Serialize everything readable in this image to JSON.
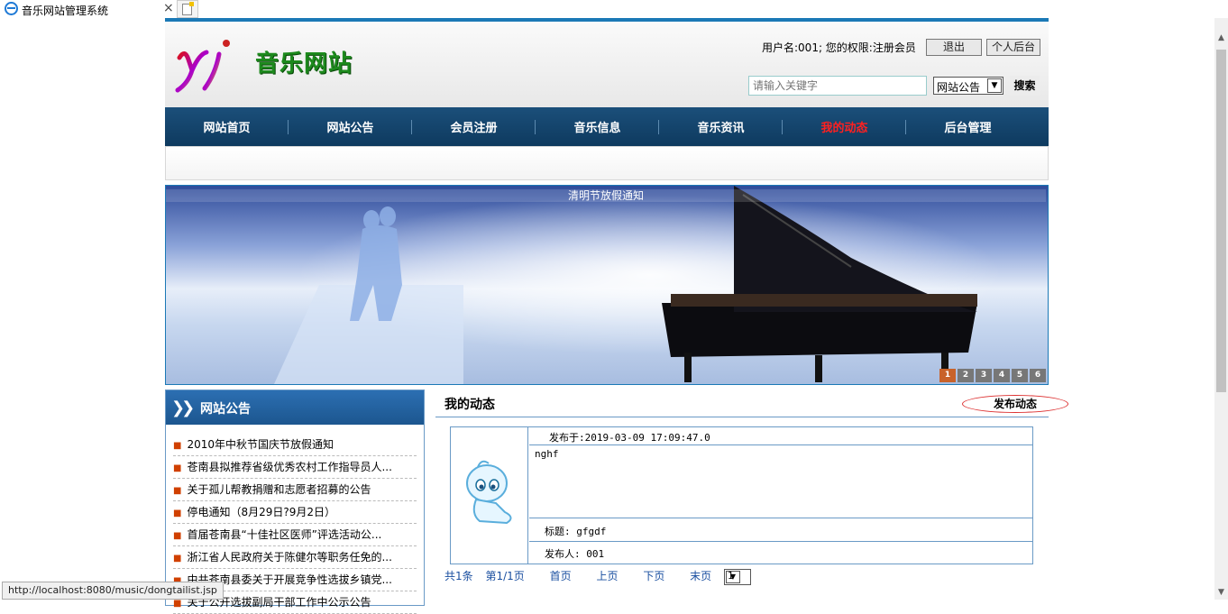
{
  "browser": {
    "tab_title": "音乐网站管理系统",
    "close_glyph": "×",
    "status_url": "http://localhost:8080/music/dongtailist.jsp"
  },
  "header": {
    "logo_text": "音乐网站",
    "user_info": "用户名:001; 您的权限:注册会员",
    "logout_label": "退出",
    "backend_label": "个人后台",
    "search_placeholder": "请输入关键字",
    "search_scope": "网站公告",
    "search_label": "搜索"
  },
  "nav": {
    "items": [
      "网站首页",
      "网站公告",
      "会员注册",
      "音乐信息",
      "音乐资讯",
      "我的动态",
      "后台管理"
    ],
    "active_color": "#ff2020"
  },
  "banner": {
    "caption": "清明节放假通知",
    "dots": [
      "1",
      "2",
      "3",
      "4",
      "5",
      "6"
    ]
  },
  "sidebar": {
    "title": "网站公告",
    "items": [
      "2010年中秋节国庆节放假通知",
      "苍南县拟推荐省级优秀农村工作指导员人...",
      "关于孤儿帮教捐赠和志愿者招募的公告",
      "停电通知（8月29日?9月2日）",
      "首届苍南县“十佳社区医师”评选活动公...",
      "浙江省人民政府关于陈健尔等职务任免的...",
      "中共苍南县委关于开展竞争性选拔乡镇党...",
      "关于公开选拔副局干部工作中公示公告"
    ]
  },
  "main": {
    "title": "我的动态",
    "publish_label": "发布动态",
    "post": {
      "published": "发布于:2019-03-09 17:09:47.0",
      "content": "nghf",
      "subject": "标题: gfgdf",
      "author": "发布人: 001"
    },
    "pager": {
      "total": "共1条",
      "page": "第1/1页",
      "first": "首页",
      "prev": "上页",
      "next": "下页",
      "last": "末页",
      "current": "1"
    }
  }
}
